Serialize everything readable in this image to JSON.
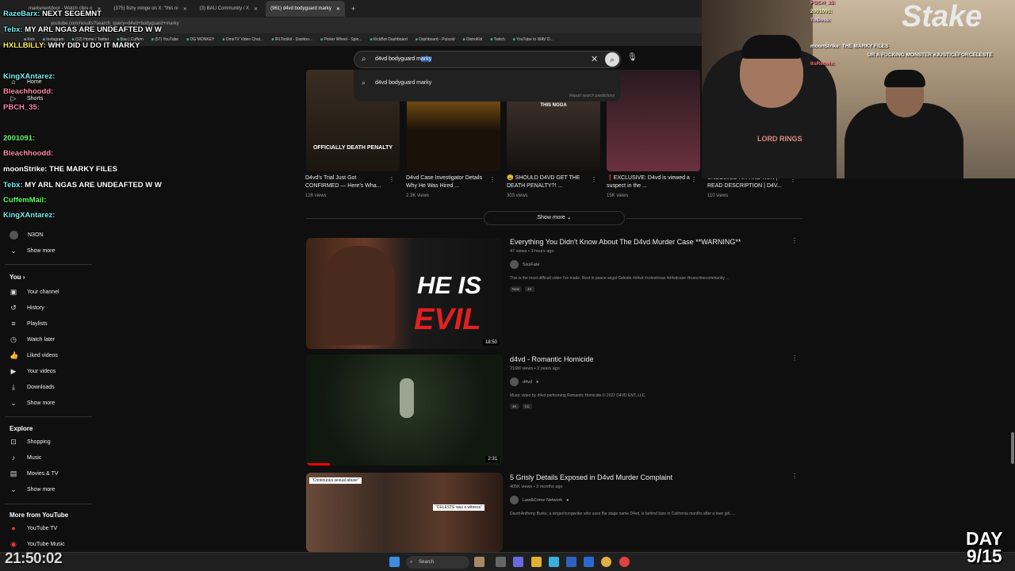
{
  "browser": {
    "tabs": [
      {
        "label": "markynextdoor - Watch clips o",
        "active": false
      },
      {
        "label": "(375) fishy minge on X: \"this ni",
        "active": false
      },
      {
        "label": "(3) BAU Community / X",
        "active": false
      },
      {
        "label": "(961) d4vd bodyguard marky",
        "active": true
      }
    ],
    "new_tab": "+",
    "url": "youtube.com/results?search_query=d4vd+bodyguard+marky",
    "bookmarks": [
      "Kick",
      "Instagram",
      "(12) Home / Twitter",
      "Bau | Cuffem",
      "(57) YouTube",
      "OG MONKEY",
      "OmeTV Video Chat...",
      "IRLToolkit - Dashbo...",
      "Picker Wheel - Spin...",
      "KickBot Dashboard",
      "Dashboard - Pulsoid",
      "DistroKid",
      "Twitch",
      "YouTube to WAV D..."
    ]
  },
  "search": {
    "query_prefix": "d4vd bodyguard m",
    "query_highlight": "arky",
    "suggestion": "d4vd bodyguard marky",
    "report": "Report search predictions"
  },
  "sidebar": {
    "top_items": [
      {
        "label": "Home",
        "icon": "home-icon"
      },
      {
        "label": "Shorts",
        "icon": "shorts-icon"
      }
    ],
    "subs": [
      {
        "label": "N3ON"
      }
    ],
    "show_more": "Show more",
    "you_header": "You",
    "you_items": [
      {
        "label": "Your channel"
      },
      {
        "label": "History"
      },
      {
        "label": "Playlists"
      },
      {
        "label": "Watch later"
      },
      {
        "label": "Liked videos"
      },
      {
        "label": "Your videos"
      },
      {
        "label": "Downloads"
      },
      {
        "label": "Show more"
      }
    ],
    "explore_header": "Explore",
    "explore_items": [
      {
        "label": "Shopping"
      },
      {
        "label": "Music"
      },
      {
        "label": "Movies & TV"
      },
      {
        "label": "Show more"
      }
    ],
    "more_header": "More from YouTube",
    "more_items": [
      {
        "label": "YouTube TV"
      },
      {
        "label": "YouTube Music"
      }
    ]
  },
  "shorts": [
    {
      "title": "D4vd's Trial Just Got CONFIRMED — Here's Wha...",
      "views": "126 views",
      "overlay": "OFFICIALLY DEATH PENALTY"
    },
    {
      "title": "D4vd Case Investigator Details Why He Was Hired ...",
      "views": "2.3K views",
      "overlay": ""
    },
    {
      "title": "😩 SHOULD D4VD GET THE DEATH PENALTY?! ...",
      "views": "303 views",
      "overlay": "THIS NGGA"
    },
    {
      "title": "❗EXCLUSIVE: D4vd is viewed a suspect in the ...",
      "views": "15K views",
      "overlay": ""
    },
    {
      "title": "UNSOLVED HIT AND RUN | READ DESCRIPTION | D4V...",
      "views": "110 views",
      "overlay": ""
    }
  ],
  "show_more": "Show more",
  "videos": [
    {
      "title": "Everything You Didn't Know About The D4vd Murder Case **WARNING**",
      "meta": "47 views • 3 hours ago",
      "channel": "SissFate",
      "desc": "This is the most difficult video I've made. Rest in peace angel Celeste #d4vd #celestrivas #d4vdcase #truecrimecommunity ...",
      "badges": [
        "New",
        "4K"
      ],
      "duration": "18:50",
      "thumb_text_1": "HE IS",
      "thumb_text_2": "EVIL"
    },
    {
      "title": "d4vd - Romantic Homicide",
      "meta": "216M views • 3 years ago",
      "channel": "d4vd",
      "desc": "Music video by d4vd performing Romantic Homicide.© 2022 D4VD ENT, LLC.",
      "badges": [
        "4K",
        "CC"
      ],
      "duration": "2:31"
    },
    {
      "title": "5 Grisly Details Exposed in D4vd Murder Complaint",
      "meta": "405K views • 3 months ago",
      "channel": "Law&Crime Network",
      "desc": "David Anthony Burke, a singer/songwriter who uses the stage name D4vd, is behind bars in California months after a teen girl, ...",
      "thumb_caption_1": "\"Continuous sexual abuse\"",
      "thumb_caption_2": "\"CELESTE was a witness\""
    }
  ],
  "chat": [
    {
      "user": "RazeBarx:",
      "msg": "NEXT SEGEMNT"
    },
    {
      "user": "Tebx:",
      "msg": "MY ARL NGAS ARE UNDEAFTED W W"
    },
    {
      "user": "HXLLBILLY:",
      "msg": "WHY DID U DO IT MARKY"
    },
    {
      "user": "KingXAntarez:",
      "msg": ""
    },
    {
      "user": "Bleachhoodd:",
      "msg": ""
    },
    {
      "user": "PBCH_35:",
      "msg": ""
    },
    {
      "user": "2001091:",
      "msg": ""
    },
    {
      "user": "Bleachhoodd:",
      "msg": ""
    },
    {
      "user": "moonStrike:",
      "msg": "THE MARKY FILES"
    },
    {
      "user": "Tebx:",
      "msg": "MY ARL NGAS ARE UNDEAFTED W W"
    },
    {
      "user": "CuffemMail:",
      "msg": ""
    },
    {
      "user": "KingXAntarez:",
      "msg": ""
    }
  ],
  "stream_chat": [
    "PBCH_35:",
    "2001091:",
    "ToBoss:",
    "moonStrike: THE MARKY FILES",
    "UR A FUCKING MONSTER #JUSTICEFORCELESTE",
    "ItsRebelx:"
  ],
  "stream": {
    "logo": "Stake",
    "shirt": "LORD RINGS"
  },
  "taskbar": {
    "search": "Search"
  },
  "overlay": {
    "clock": "21:50:02",
    "day_label": "DAY",
    "day_value": "9/15"
  }
}
